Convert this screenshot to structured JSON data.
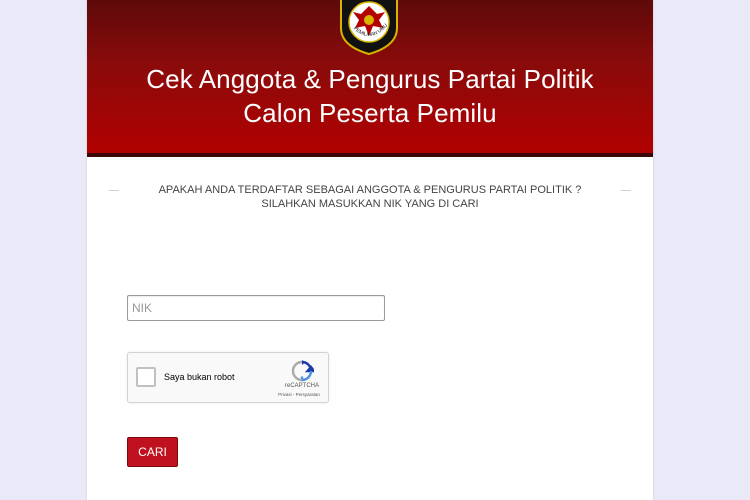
{
  "header": {
    "title_line1": "Cek Anggota & Pengurus Partai Politik",
    "title_line2": "Calon Peserta Pemilu",
    "logo_icon": "kpu-garuda-logo-icon",
    "logo_text": "PEMILIHAN UMUM"
  },
  "notice": {
    "line1": "APAKAH ANDA TERDAFTAR SEBAGAI ANGGOTA & PENGURUS PARTAI POLITIK ?",
    "line2": "SILAHKAN MASUKKAN NIK YANG DI CARI"
  },
  "form": {
    "nik_placeholder": "NIK",
    "nik_value": "",
    "recaptcha_label": "Saya bukan robot",
    "recaptcha_brand": "reCAPTCHA",
    "recaptcha_privacy": "Privasi",
    "recaptcha_separator": " - ",
    "recaptcha_terms": "Persyaratan",
    "submit_label": "CARI"
  },
  "colors": {
    "header_dark": "#5e0a0a",
    "header_red": "#b30000",
    "button_red": "#c0121e",
    "page_background": "#e9e9f7"
  }
}
